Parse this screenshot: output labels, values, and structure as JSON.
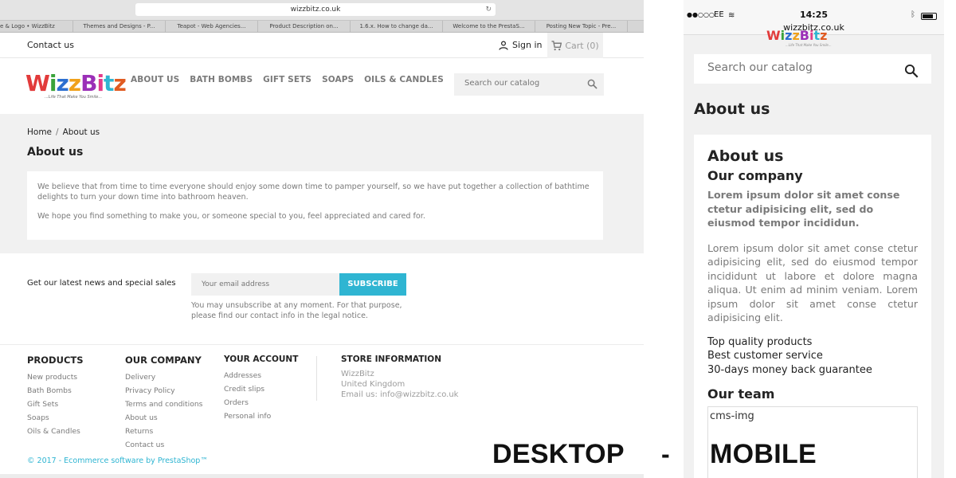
{
  "browser": {
    "url": "wizzbitz.co.uk",
    "tabs": [
      "e & Logo • WizzBitz",
      "Themes and Designs - P...",
      "Teapot - Web Agencies...",
      "Product Description on...",
      "1.6.x. How to change da...",
      "Welcome to the PrestaS...",
      "Posting New Topic - Pre..."
    ]
  },
  "desktop": {
    "nav": {
      "contact": "Contact us",
      "sign_in": "Sign in",
      "cart": "Cart (0)"
    },
    "logo": {
      "text": "WizzBitz",
      "tagline": "...Life That Make You Smile..."
    },
    "menu": [
      "ABOUT US",
      "BATH BOMBS",
      "GIFT SETS",
      "SOAPS",
      "OILS & CANDLES"
    ],
    "search_placeholder": "Search our catalog",
    "breadcrumb": {
      "home": "Home",
      "sep": "/",
      "current": "About us"
    },
    "page_title": "About us",
    "paragraphs": [
      "We believe that from time to time everyone should enjoy some down time to pamper yourself, so we have put together a collection of bathtime delights to turn your down time into bathroom heaven.",
      "We hope you find something to make you, or someone special to you, feel appreciated and cared for."
    ],
    "newsletter": {
      "label": "Get our latest news and special sales",
      "placeholder": "Your email address",
      "button": "SUBSCRIBE",
      "note": "You may unsubscribe at any moment. For that purpose, please find our contact info in the legal notice."
    },
    "footer": {
      "products": {
        "title": "PRODUCTS",
        "links": [
          "New products",
          "Bath Bombs",
          "Gift Sets",
          "Soaps",
          "Oils & Candles"
        ]
      },
      "company": {
        "title": "OUR COMPANY",
        "links": [
          "Delivery",
          "Privacy Policy",
          "Terms and conditions",
          "About us",
          "Returns",
          "Contact us"
        ]
      },
      "account": {
        "title": "YOUR ACCOUNT",
        "links": [
          "Addresses",
          "Credit slips",
          "Orders",
          "Personal info"
        ]
      },
      "store": {
        "title": "STORE INFORMATION",
        "name": "WizzBitz",
        "country": "United Kingdom",
        "email": "Email us: info@wizzbitz.co.uk"
      },
      "copyright": "© 2017 - Ecommerce software by PrestaShop™"
    }
  },
  "labels": {
    "desktop": "DESKTOP",
    "dash": "-",
    "mobile": "MOBILE"
  },
  "mobile": {
    "status": {
      "signal": "●●○○○",
      "carrier": "EE",
      "time": "14:25"
    },
    "url": "wizzbitz.co.uk",
    "search_placeholder": "Search our catalog",
    "page_title": "About us",
    "card": {
      "h1": "About us",
      "h2": "Our company",
      "lead": "Lorem ipsum dolor sit amet conse ctetur adipisicing elit, sed do eiusmod tempor incididun.",
      "body": "Lorem ipsum dolor sit amet conse ctetur adipisicing elit, sed do eiusmod tempor incididunt ut labore et dolore magna aliqua. Ut enim ad minim veniam. Lorem ipsum dolor sit amet conse ctetur adipisicing elit.",
      "features": [
        "Top quality products",
        "Best customer service",
        "30-days money back guarantee"
      ],
      "team": "Our team",
      "img_alt": "cms-img"
    }
  },
  "colors": {
    "accent": "#2fb5d2",
    "text": "#232323",
    "muted": "#7a7a7a",
    "bg_grey": "#f1f1f1"
  }
}
